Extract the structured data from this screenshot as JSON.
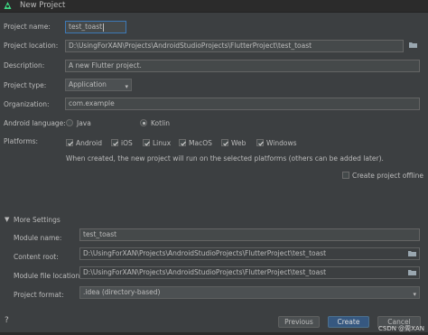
{
  "window": {
    "title": "New Project"
  },
  "form": {
    "project_name": {
      "label": "Project name:",
      "value": "test_toast"
    },
    "project_location": {
      "label": "Project location:",
      "value": "D:\\UsingForXAN\\Projects\\AndroidStudioProjects\\FlutterProject\\test_toast"
    },
    "description": {
      "label": "Description:",
      "value": "A new Flutter project."
    },
    "project_type": {
      "label": "Project type:",
      "value": "Application"
    },
    "organization": {
      "label": "Organization:",
      "value": "com.example"
    },
    "android_language": {
      "label": "Android language:",
      "options": [
        "Java",
        "Kotlin"
      ],
      "selected": "Kotlin"
    },
    "platforms": {
      "label": "Platforms:",
      "items": [
        {
          "label": "Android",
          "checked": true
        },
        {
          "label": "iOS",
          "checked": true
        },
        {
          "label": "Linux",
          "checked": true
        },
        {
          "label": "MacOS",
          "checked": true
        },
        {
          "label": "Web",
          "checked": true
        },
        {
          "label": "Windows",
          "checked": true
        }
      ],
      "note": "When created, the new project will run on the selected platforms (others can be added later)."
    },
    "create_offline": {
      "label": "Create project offline",
      "checked": false
    }
  },
  "more_settings": {
    "label": "More Settings",
    "module_name": {
      "label": "Module name:",
      "value": "test_toast"
    },
    "content_root": {
      "label": "Content root:",
      "value": "D:\\UsingForXAN\\Projects\\AndroidStudioProjects\\FlutterProject\\test_toast"
    },
    "module_file_location": {
      "label": "Module file location:",
      "value": "D:\\UsingForXAN\\Projects\\AndroidStudioProjects\\FlutterProject\\test_toast"
    },
    "project_format": {
      "label": "Project format:",
      "value": ".idea (directory-based)"
    }
  },
  "buttons": {
    "previous": "Previous",
    "create": "Create",
    "cancel": "Cancel"
  },
  "watermark": "CSDN @周XAN",
  "colors": {
    "background": "#3c3f41",
    "primary_button": "#365880",
    "field": "#45494a",
    "text": "#bbbbbb"
  }
}
